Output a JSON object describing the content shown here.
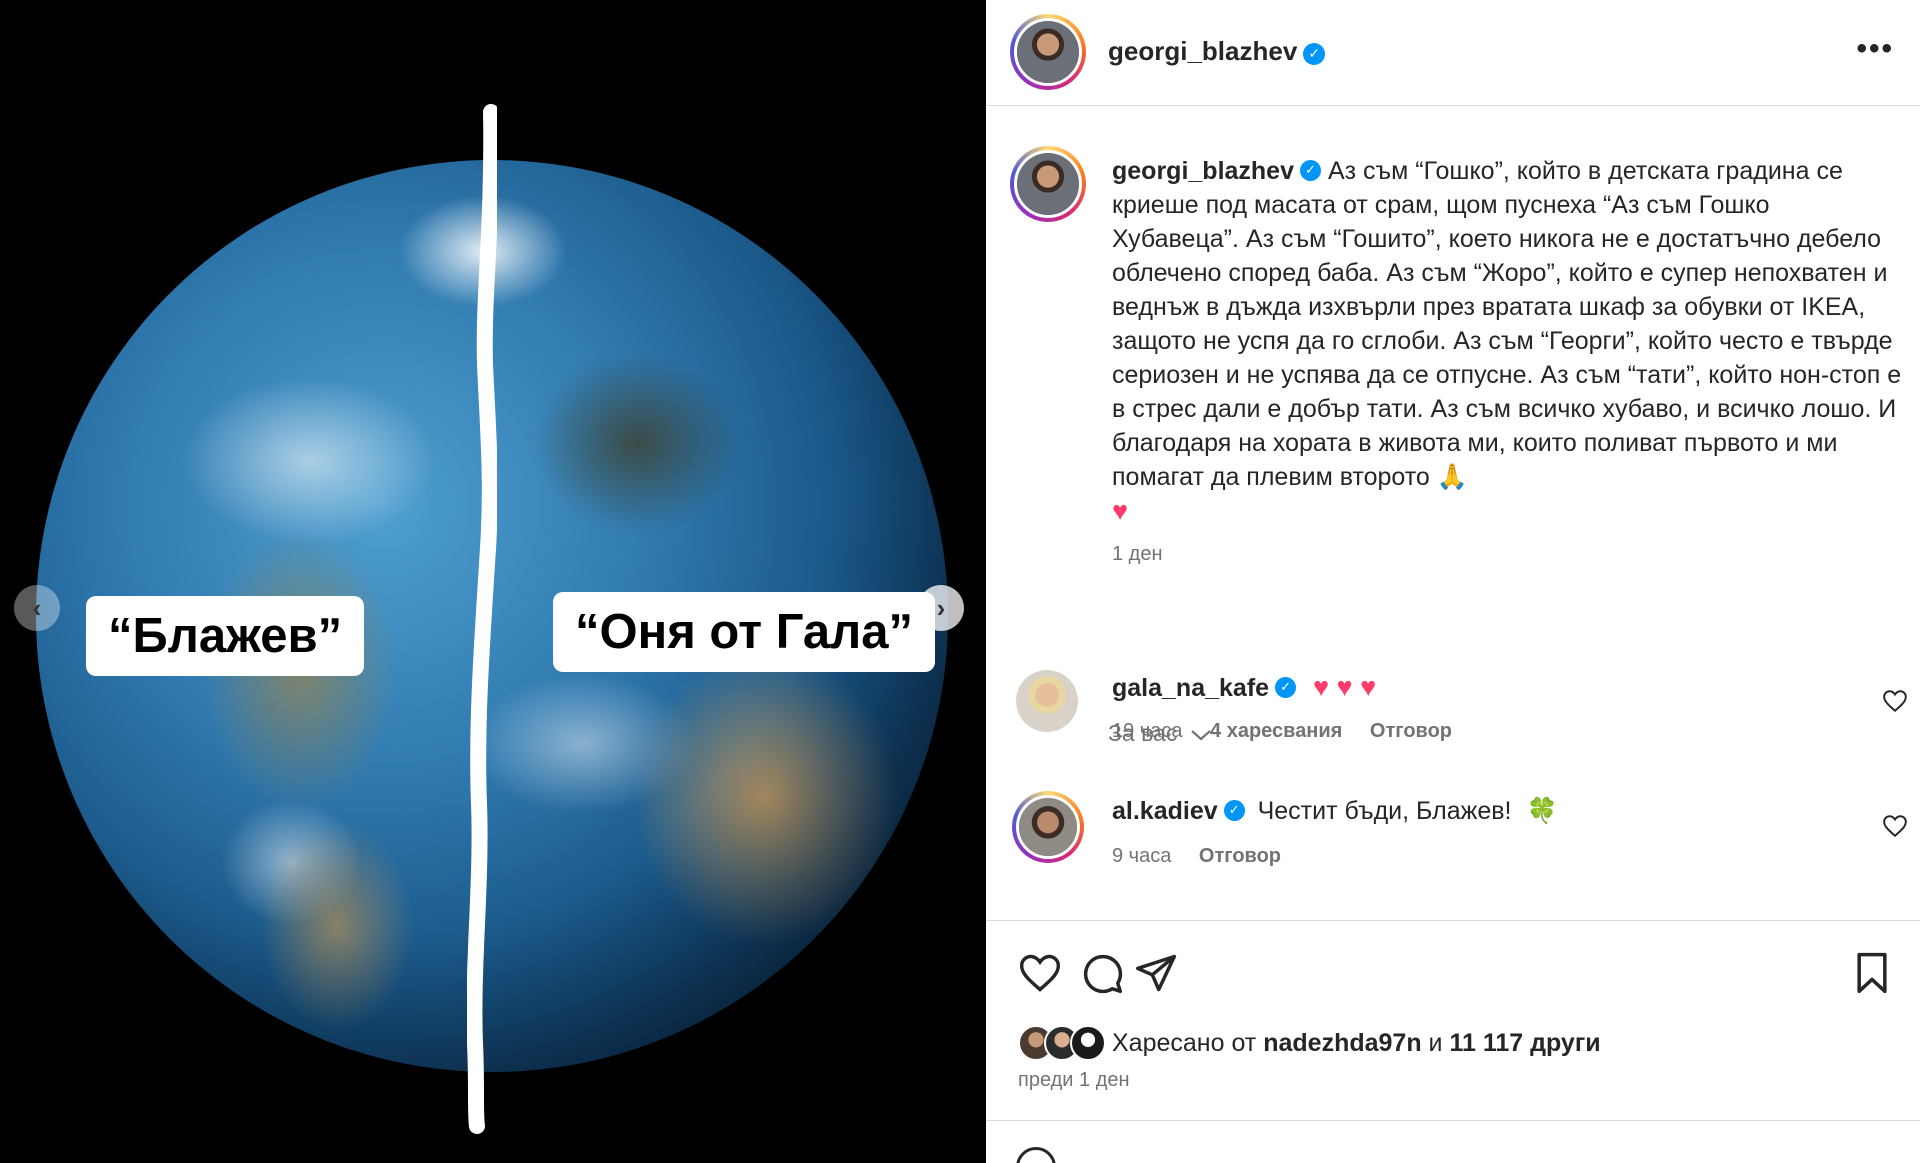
{
  "media": {
    "left_label": "“Блажев”",
    "right_label": "“Оня от Гала”",
    "prev_icon": "chevron-left",
    "next_icon": "chevron-right"
  },
  "post": {
    "author": "georgi_blazhev",
    "verified": true,
    "more_label": "•••",
    "caption": "Аз съм “Гошко”, който в детската градина се криеше под масата от срам, щом пуснеха “Аз съм Гошко Хубавеца”. Аз съм “Гошито”, което никога не е достатъчно дебело облечено според баба. Аз съм “Жоро”, който е супер непохватен и веднъж в дъжда изхвърли през вратата шкаф за обувки от IKEA, защото не успя да го сглоби. Аз съм “Георги”, който често е твърде сериозен и не успява да се отпусне. Аз съм “тати”, който нон-стоп е в стрес дали е добър тати. Аз съм всичко хубаво, и всичко лошо. И благодаря на хората в живота ми, които поливат първото и ми помагат да плевим второто",
    "caption_emoji_1": "🙏",
    "caption_emoji_2": "♥",
    "caption_time": "1 ден",
    "for_you_label": "За вас"
  },
  "comments": [
    {
      "user": "gala_na_kafe",
      "text": "♥ ♥ ♥",
      "time": "19 часа",
      "likes": "4 харесвания",
      "reply": "Отговор"
    },
    {
      "user": "al.kadiev",
      "text": "Честит бъди, Блажев!",
      "emoji": "🍀",
      "time": "9 часа",
      "reply": "Отговор"
    }
  ],
  "actions": {
    "liked_by_prefix": "Харесано от",
    "liked_by_user": "nadezhda97n",
    "liked_by_joiner": "и",
    "liked_by_others": "11 117 други",
    "posted": "преди 1 ден"
  },
  "colors": {
    "verified": "#0095f6",
    "muted_text": "#737373",
    "border": "#dbdbdb",
    "heart": "#ff3b6b"
  }
}
